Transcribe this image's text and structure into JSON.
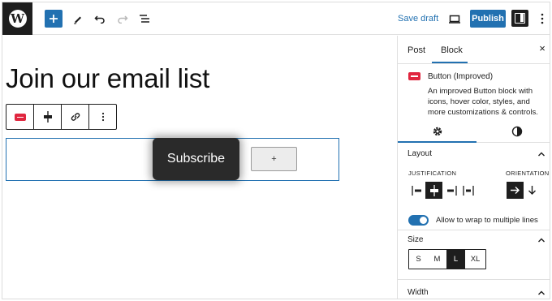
{
  "topbar": {
    "logo_letter": "W",
    "save_draft": "Save draft",
    "publish": "Publish"
  },
  "canvas": {
    "heading": "Join our email list",
    "button_text": "Subscribe",
    "appender_symbol": "+"
  },
  "sidebar": {
    "tabs": [
      "Post",
      "Block"
    ],
    "active_tab": "Block",
    "close_symbol": "×",
    "block_card": {
      "title": "Button (Improved)",
      "description": "An improved Button block with icons, hover color, styles, and more customizations & controls."
    },
    "layout": {
      "title": "Layout",
      "justification_label": "JUSTIFICATION",
      "orientation_label": "ORIENTATION",
      "justification_active": "center",
      "orientation_active": "horizontal",
      "wrap_label": "Allow to wrap to multiple lines",
      "wrap_enabled": true
    },
    "size": {
      "title": "Size",
      "options": [
        "S",
        "M",
        "L",
        "XL"
      ],
      "selected": "L"
    },
    "width": {
      "title": "Width"
    }
  },
  "colors": {
    "accent": "#2271b1",
    "dark": "#1e1e1e",
    "block_icon": "#e0263f"
  }
}
